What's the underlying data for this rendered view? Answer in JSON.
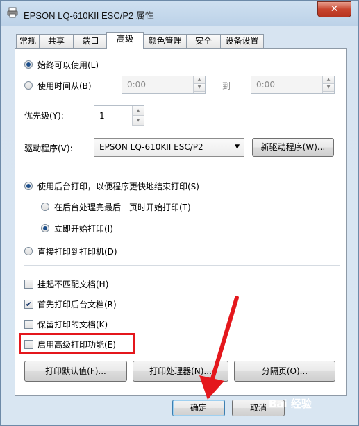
{
  "window": {
    "title": "EPSON LQ-610KII ESC/P2 属性",
    "close_label": "✕"
  },
  "tabs": [
    "常规",
    "共享",
    "端口",
    "高级",
    "颜色管理",
    "安全",
    "设备设置"
  ],
  "availability": {
    "always_label": "始终可以使用(L)",
    "from_label": "使用时间从(B)",
    "from_value": "0:00",
    "to_label": "到",
    "to_value": "0:00"
  },
  "priority": {
    "label": "优先级(Y):",
    "value": "1"
  },
  "driver": {
    "label": "驱动程序(V):",
    "value": "EPSON LQ-610KII ESC/P2",
    "new_button": "新驱动程序(W)..."
  },
  "spooling": {
    "spool_label": "使用后台打印，以便程序更快地结束打印(S)",
    "after_last_page": "在后台处理完最后一页时开始打印(T)",
    "immediately": "立即开始打印(I)",
    "direct": "直接打印到打印机(D)"
  },
  "options": {
    "hold_mismatched": "挂起不匹配文档(H)",
    "spooled_first": "首先打印后台文档(R)",
    "keep_printed": "保留打印的文档(K)",
    "advanced_features": "启用高级打印功能(E)"
  },
  "buttons": {
    "defaults": "打印默认值(F)...",
    "processor": "打印处理器(N)...",
    "separator": "分隔页(O)...",
    "ok": "确定",
    "cancel": "取消"
  },
  "watermark": "Bai 经验",
  "colors": {
    "highlight": "#e4171c",
    "arrow": "#e4171c"
  }
}
